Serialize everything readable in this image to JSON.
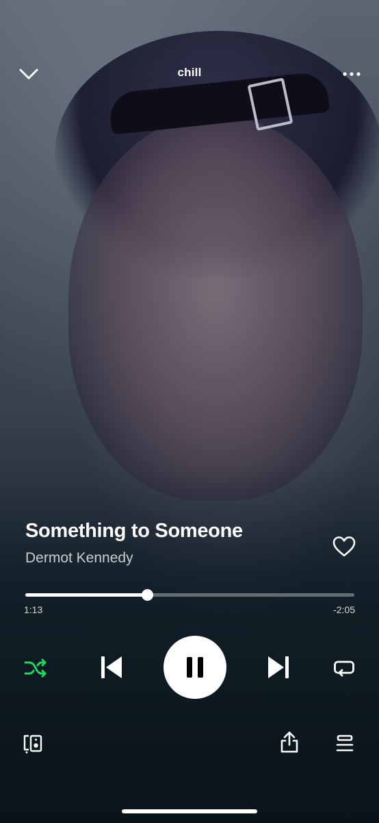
{
  "header": {
    "playlist_name": "chill"
  },
  "track": {
    "title": "Something to Someone",
    "artist": "Dermot Kennedy",
    "liked": false
  },
  "playback": {
    "elapsed": "1:13",
    "remaining": "-2:05",
    "progress_fraction": 0.37,
    "is_playing": true,
    "shuffle_on": true,
    "repeat_mode": "off"
  },
  "icons": {
    "collapse": "chevron-down-icon",
    "more": "more-horizontal-icon",
    "like": "heart-outline-icon",
    "shuffle": "shuffle-icon",
    "previous": "skip-previous-icon",
    "pause": "pause-icon",
    "next": "skip-next-icon",
    "repeat": "repeat-icon",
    "devices": "connect-devices-icon",
    "share": "share-icon",
    "queue": "queue-icon"
  },
  "colors": {
    "accent": "#1ed760",
    "text_primary": "#ffffff",
    "text_secondary": "#c9cdd2"
  }
}
